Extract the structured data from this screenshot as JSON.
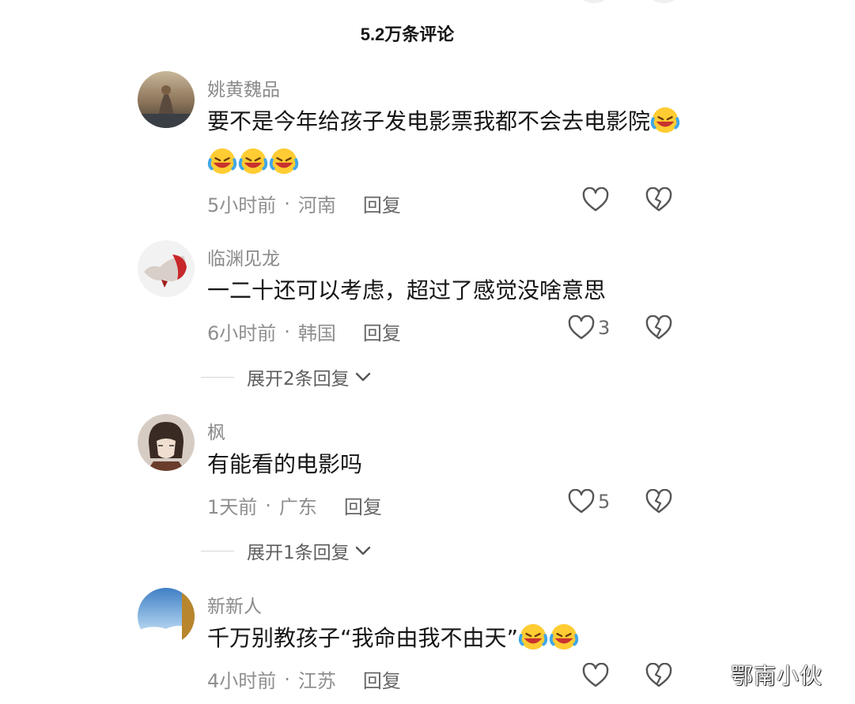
{
  "header": {
    "title": "5.2万条评论"
  },
  "comments": [
    {
      "username": "姚黄魏品",
      "text": "要不是今年给孩子发电影票我都不会去电影院",
      "emoji_count": 4,
      "time": "5小时前",
      "location": "河南",
      "reply_label": "回复",
      "likes": ""
    },
    {
      "username": "临渊见龙",
      "text": "一二十还可以考虑，超过了感觉没啥意思",
      "time": "6小时前",
      "location": "韩国",
      "reply_label": "回复",
      "likes": "3",
      "expand_label": "展开2条回复"
    },
    {
      "username": "枫",
      "text": "有能看的电影吗",
      "time": "1天前",
      "location": "广东",
      "reply_label": "回复",
      "likes": "5",
      "expand_label": "展开1条回复"
    },
    {
      "username": "新新人",
      "text": "千万别教孩子“我命由我不由天”",
      "emoji_count": 2,
      "time": "4小时前",
      "location": "江苏",
      "reply_label": "回复",
      "likes": ""
    }
  ],
  "separator": "·",
  "icons": {
    "like": "heart-outline-icon",
    "dislike": "broken-heart-icon",
    "emoji": "rofl-laughing-emoji",
    "expand": "chevron-down-icon"
  },
  "watermark": "鄂南小伙",
  "colors": {
    "username": "#8a8a8a",
    "meta": "#8f8f8f",
    "text": "#161616"
  }
}
